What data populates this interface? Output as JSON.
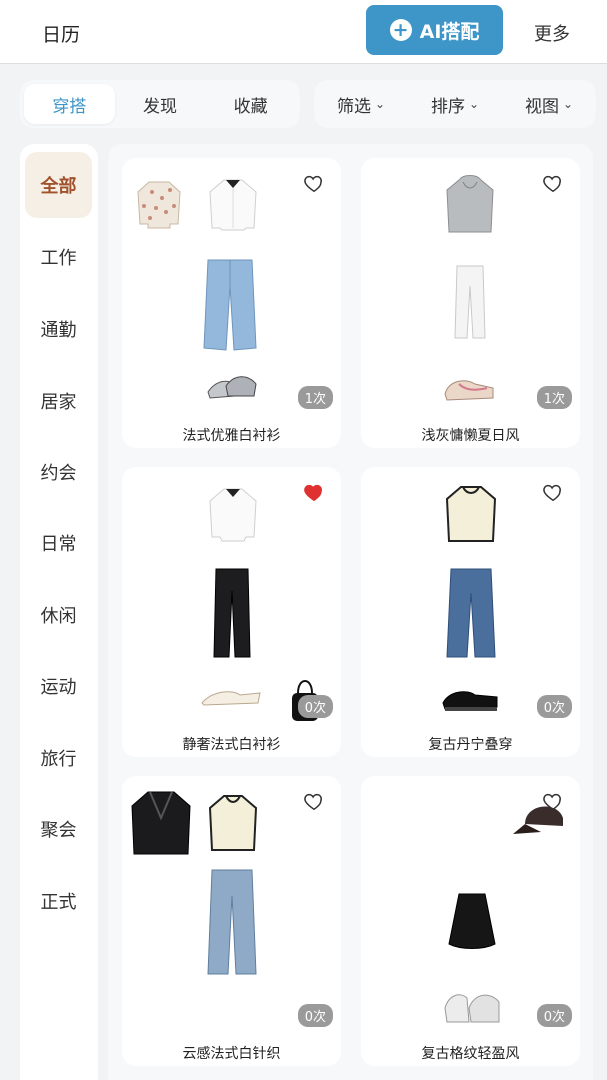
{
  "header": {
    "title": "日历",
    "ai_button": "AI搭配",
    "more": "更多"
  },
  "tabs": [
    {
      "label": "穿搭",
      "active": true
    },
    {
      "label": "发现",
      "active": false
    },
    {
      "label": "收藏",
      "active": false
    }
  ],
  "tools": [
    {
      "label": "筛选",
      "icon": "chevron-down-icon"
    },
    {
      "label": "排序",
      "icon": "chevron-down-icon"
    },
    {
      "label": "视图",
      "icon": "chevron-down-icon"
    }
  ],
  "categories": [
    "全部",
    "工作",
    "通勤",
    "居家",
    "约会",
    "日常",
    "休闲",
    "运动",
    "旅行",
    "聚会",
    "正式"
  ],
  "active_category": "全部",
  "outfits": [
    {
      "name": "法式优雅白衬衫",
      "count": "1次",
      "favorited": false
    },
    {
      "name": "浅灰慵懒夏日风",
      "count": "1次",
      "favorited": false
    },
    {
      "name": "静奢法式白衬衫",
      "count": "0次",
      "favorited": true
    },
    {
      "name": "复古丹宁叠穿",
      "count": "0次",
      "favorited": false
    },
    {
      "name": "云感法式白针织",
      "count": "0次",
      "favorited": false
    },
    {
      "name": "复古格纹轻盈风",
      "count": "0次",
      "favorited": false
    }
  ],
  "colors": {
    "accent": "#3d95c8",
    "heart_active": "#e03131",
    "badge": "#9a9a9a",
    "active_category_bg": "#f6efe5"
  }
}
